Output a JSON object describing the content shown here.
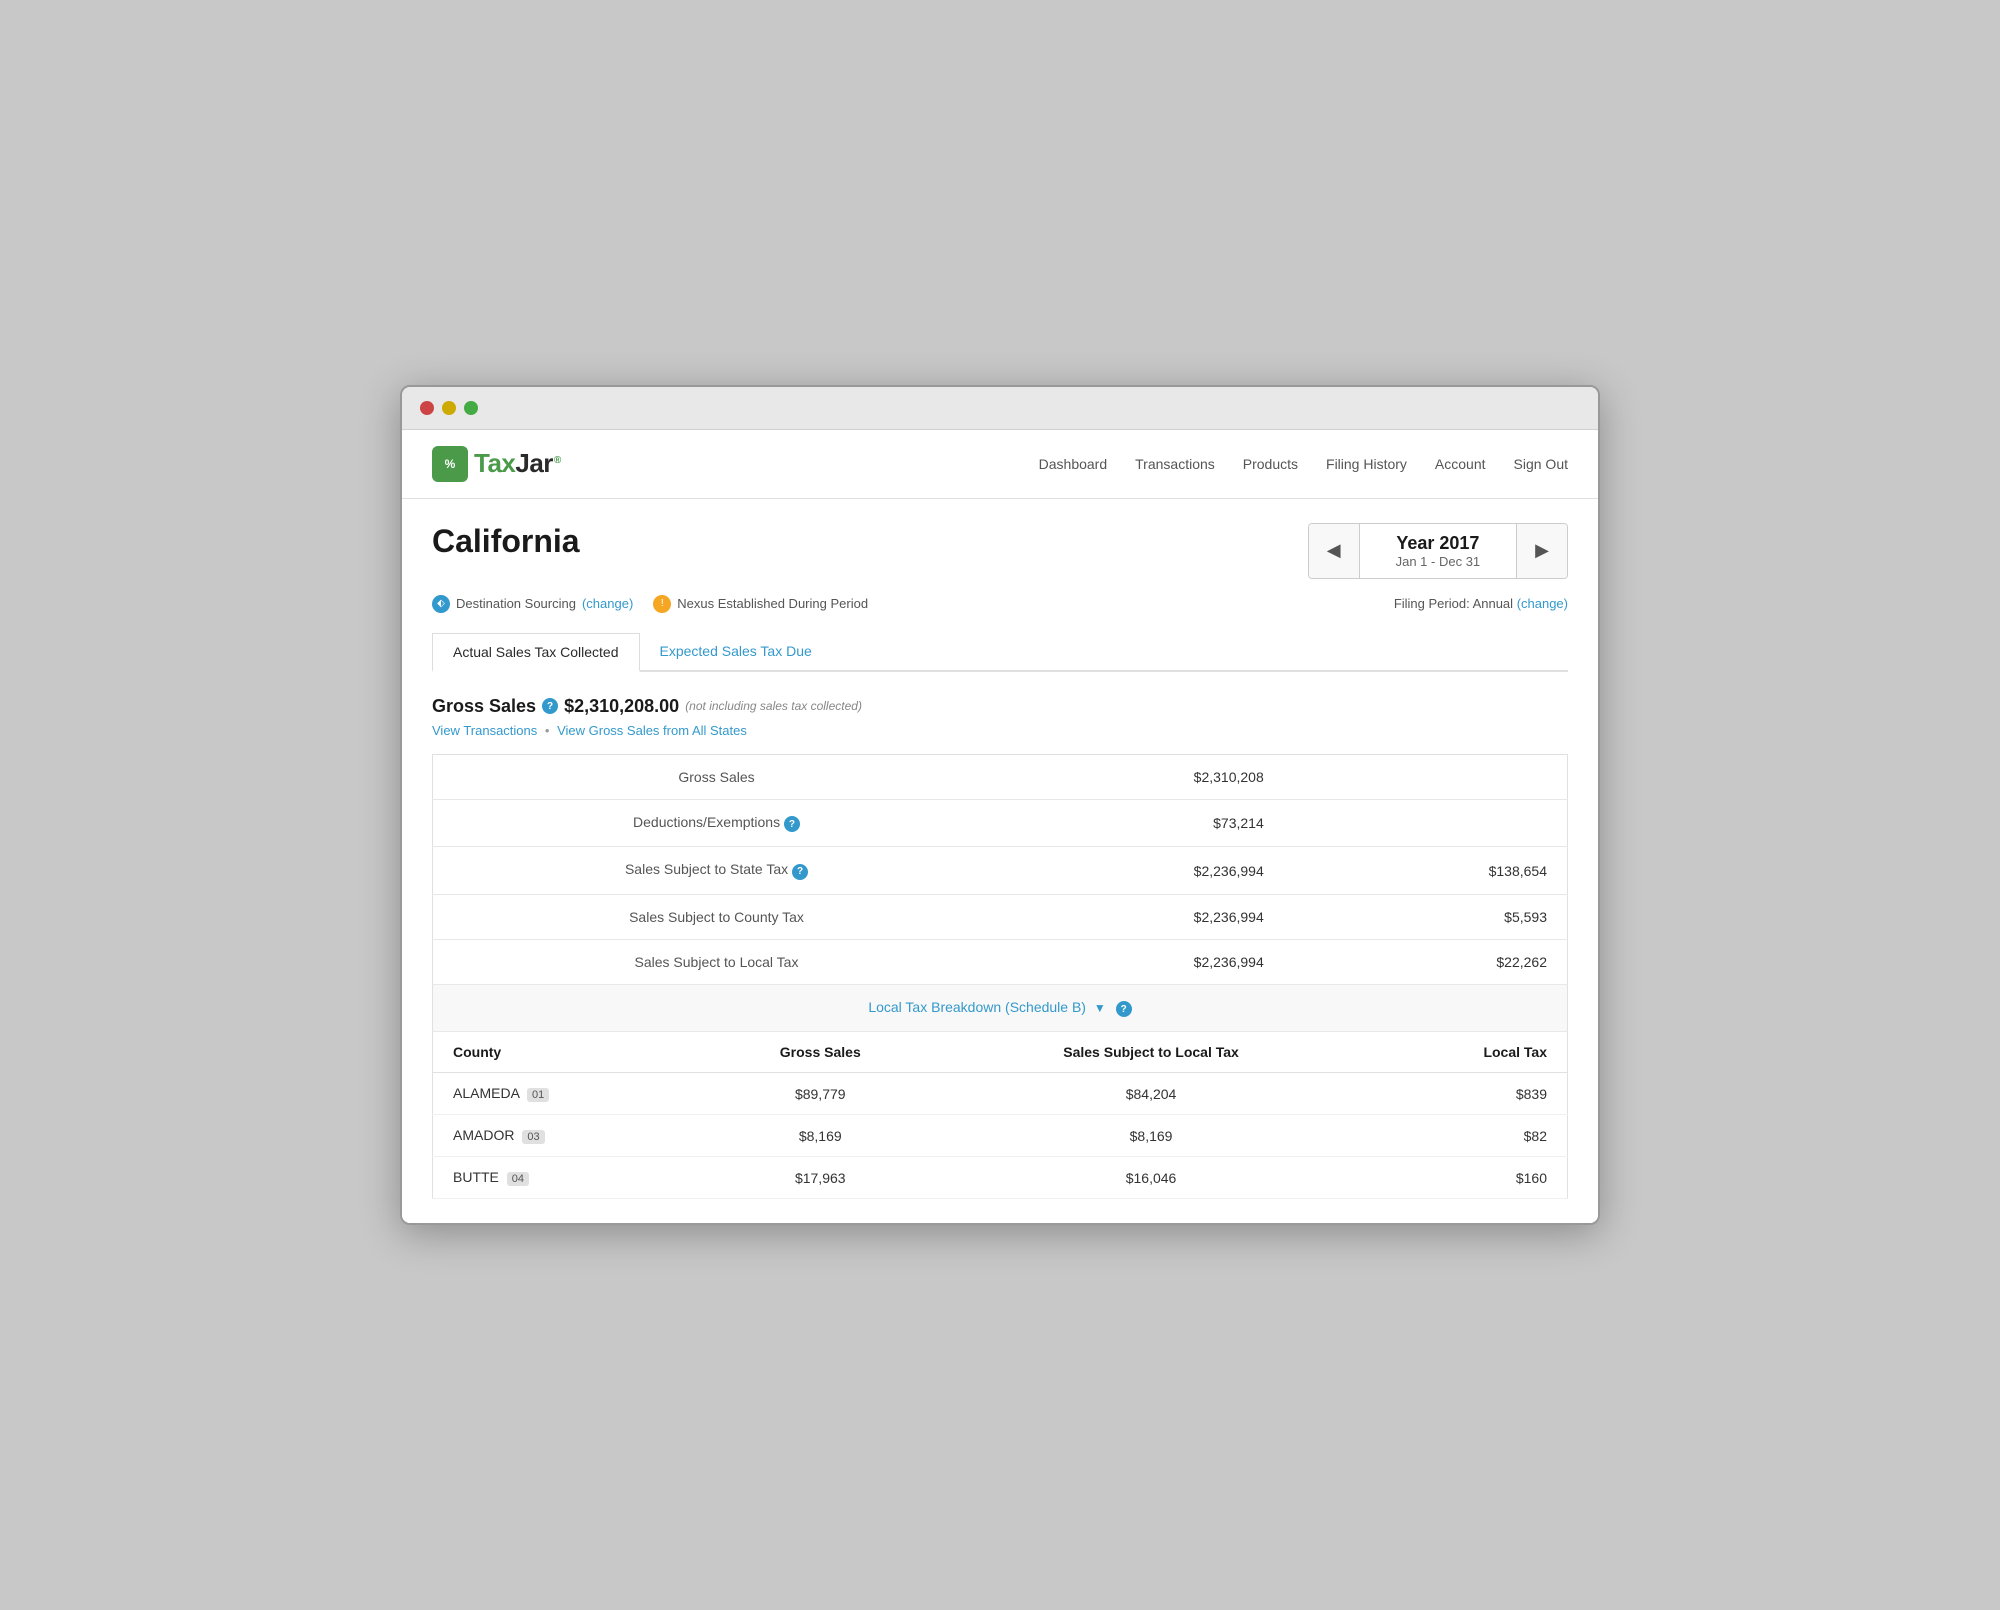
{
  "window": {
    "dots": [
      "red",
      "yellow",
      "green"
    ]
  },
  "nav": {
    "logo_text": "TaxJar",
    "logo_tm": "®",
    "links": [
      {
        "label": "Dashboard",
        "name": "dashboard"
      },
      {
        "label": "Transactions",
        "name": "transactions"
      },
      {
        "label": "Products",
        "name": "products"
      },
      {
        "label": "Filing History",
        "name": "filing-history"
      },
      {
        "label": "Account",
        "name": "account"
      },
      {
        "label": "Sign Out",
        "name": "sign-out"
      }
    ]
  },
  "header": {
    "state_name": "California",
    "year_label": "Year 2017",
    "date_range": "Jan 1 - Dec 31",
    "prev_btn": "◀",
    "next_btn": "▶"
  },
  "meta": {
    "sourcing": "Destination Sourcing",
    "sourcing_change": "(change)",
    "nexus": "Nexus Established During Period",
    "filing_period": "Filing Period: Annual",
    "filing_change": "(change)"
  },
  "tabs": [
    {
      "label": "Actual Sales Tax Collected",
      "name": "actual-tab",
      "active": true
    },
    {
      "label": "Expected Sales Tax Due",
      "name": "expected-tab",
      "active": false
    }
  ],
  "gross_sales": {
    "title": "Gross Sales",
    "amount": "$2,310,208.00",
    "note": "(not including sales tax collected)",
    "view_transactions": "View Transactions",
    "separator": "•",
    "view_gross": "View Gross Sales from All States"
  },
  "table_rows": [
    {
      "label": "Gross Sales",
      "value": "$2,310,208",
      "extra": ""
    },
    {
      "label": "Deductions/Exemptions",
      "value": "$73,214",
      "extra": "",
      "has_help": true
    },
    {
      "label": "Sales Subject to State Tax",
      "value": "$2,236,994",
      "extra": "$138,654",
      "has_help": true
    },
    {
      "label": "Sales Subject to County Tax",
      "value": "$2,236,994",
      "extra": "$5,593",
      "has_help": false
    },
    {
      "label": "Sales Subject to Local Tax",
      "value": "$2,236,994",
      "extra": "$22,262",
      "has_help": false
    }
  ],
  "breakdown": {
    "link_label": "Local Tax Breakdown (Schedule B)",
    "arrow": "▼"
  },
  "county_table": {
    "headers": [
      "County",
      "Gross Sales",
      "Sales Subject to Local Tax",
      "Local Tax"
    ],
    "rows": [
      {
        "county": "ALAMEDA",
        "badge": "01",
        "gross": "$89,779",
        "subject": "$84,204",
        "tax": "$839"
      },
      {
        "county": "AMADOR",
        "badge": "03",
        "gross": "$8,169",
        "subject": "$8,169",
        "tax": "$82"
      },
      {
        "county": "BUTTE",
        "badge": "04",
        "gross": "$17,963",
        "subject": "$16,046",
        "tax": "$160"
      }
    ]
  }
}
